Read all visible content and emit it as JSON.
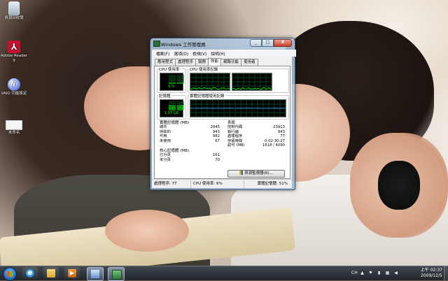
{
  "desktop": {
    "icons": [
      {
        "label": "資源回收筒"
      },
      {
        "label": "Adobe Reader 9"
      },
      {
        "label": "VAIO 功能設定"
      },
      {
        "label": "未命名"
      }
    ]
  },
  "window": {
    "title": "Windows 工作管理員",
    "controls": {
      "minimize": "_",
      "maximize": "□",
      "close": "X"
    },
    "menu": [
      "檔案(F)",
      "選項(O)",
      "檢視(V)",
      "說明(H)"
    ],
    "tabs": [
      "應用程式",
      "處理程序",
      "服務",
      "效能",
      "網路功能",
      "使用者"
    ],
    "active_tab": "效能",
    "performance": {
      "cpu_usage_label": "CPU 使用率",
      "cpu_usage_value": "6 %",
      "cpu_usage_percent": 6,
      "cpu_history_label": "CPU 使用率記錄",
      "memory_label": "記憶體",
      "memory_value": "1.03 GB",
      "memory_percent": 51,
      "memory_history_label": "實體記憶體使用記錄"
    },
    "physical_memory": {
      "title": "實體記憶體 (MB)",
      "rows": [
        {
          "label": "總共",
          "value": "2045"
        },
        {
          "label": "快取的",
          "value": "943"
        },
        {
          "label": "可用",
          "value": "982"
        },
        {
          "label": "未使用",
          "value": "67"
        }
      ]
    },
    "kernel_memory": {
      "title": "核心記憶體 (MB)",
      "rows": [
        {
          "label": "已分頁",
          "value": "161"
        },
        {
          "label": "未分頁",
          "value": "70"
        }
      ]
    },
    "system": {
      "title": "系統",
      "rows": [
        {
          "label": "控制代碼",
          "value": "23913"
        },
        {
          "label": "執行緒",
          "value": "943"
        },
        {
          "label": "處理程序",
          "value": "77"
        },
        {
          "label": "存留時間",
          "value": "0:02:30:27"
        },
        {
          "label": "認可 (MB)",
          "value": "1618 / 4090"
        }
      ]
    },
    "resource_monitor_button": "資源監視器(R)...",
    "status": {
      "processes": "處理程序: 77",
      "cpu": "CPU 使用率: 6%",
      "memory": "實體記憶體: 51%"
    }
  },
  "taskbar": {
    "tray": {
      "lang": "CH"
    },
    "clock": {
      "time": "上午 02:37",
      "date": "2009/12/5"
    }
  },
  "colors": {
    "meter_green": "#00ff00",
    "graph_grid": "#008040",
    "graph_line": "#00ff00",
    "memory_line": "#2fa7ff"
  }
}
